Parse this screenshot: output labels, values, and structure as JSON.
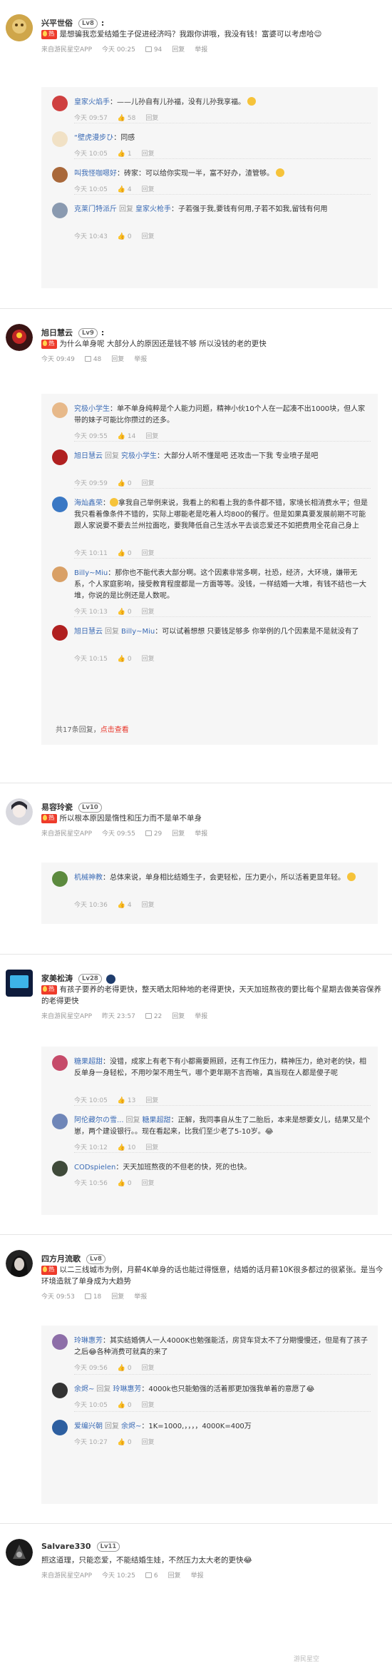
{
  "labels": {
    "reply": "回复",
    "report": "举报",
    "reply_word": "回复"
  },
  "threads": [
    {
      "user": "兴平世俗",
      "level": "Lv8",
      "badge": "热",
      "text": "是想骗我恋爱结婚生子促进经济吗？我跟你讲哦，我没有钱！富婆可以考虑哈😉",
      "source": "来自游民星空APP",
      "time": "今天 00:25",
      "likes": "94",
      "replies": [
        {
          "user": "皇家火焰手",
          "text": "——儿孙自有儿孙福，没有儿孙我享福。",
          "time": "今天 09:57",
          "likes": "58"
        },
        {
          "user": "“壁虎漫步ひ",
          "text": "同感",
          "time": "今天 10:05",
          "likes": "1"
        },
        {
          "user": "叫我怪咖嗯好",
          "text": "砖家：可以给你实现一半，富不好办，渣管够。",
          "time": "今天 10:05",
          "likes": "4"
        },
        {
          "user": "克莱门特派斤",
          "to": "皇家火枪手",
          "text": "子若强于我,要钱有何用,子若不如我,留钱有何用",
          "time": "今天 10:43",
          "likes": "0"
        }
      ]
    },
    {
      "user": "旭日慧云",
      "level": "Lv9",
      "badge": "热",
      "text": "为什么单身呢 大部分人的原因还是钱不够 所以没钱的老的更快",
      "source": "",
      "time": "今天 09:49",
      "likes": "48",
      "replies": [
        {
          "user": "究极小学生",
          "text": "单不单身纯粹是个人能力问题，精神小伙10个人在一起凑不出1000块，但人家带的妹子可能比你攒过的还多。",
          "time": "今天 09:55",
          "likes": "14"
        },
        {
          "user": "旭日慧云",
          "to": "究极小学生",
          "text": "大部分人听不懂是吧 还攻击一下我 专业喷子是吧",
          "time": "今天 09:59",
          "likes": "0"
        },
        {
          "user": "海灿鑫荣",
          "text": "拿我自己举例来说，我看上的和看上我的条件都不错，家境长相消费水平；但是我只看着像条件不错的，实际上哪能老是吃着人均800的餐厅。但是如果真要发展前期不可能跟人家说要不要去兰州拉面吃，要我降低自己生活水平去谈恋爱还不如把费用全花自己身上",
          "time": "今天 10:11",
          "likes": "0"
        },
        {
          "user": "Billy~Miu",
          "text": "那你也不能代表大部分啊。这个因素非常多啊，社恐，经济，大环境，嫌带无系，个人家庭影响，接受教育程度都是一方面等等。没钱，一样结婚一大堆，有钱不结也一大堆，你说的是比例还是人数呢。",
          "time": "今天 10:13",
          "likes": "0"
        },
        {
          "user": "旭日慧云",
          "to": "Billy~Miu",
          "text": "可以试着想想 只要钱足够多 你举例的几个因素是不是就没有了",
          "time": "今天 10:15",
          "likes": "0"
        }
      ],
      "more_count": "共17条回复，",
      "more_link": "点击查看"
    },
    {
      "user": "易容玲瓷",
      "level": "Lv10",
      "badge": "热",
      "text": "所以根本原因是惰性和压力而不是单不单身",
      "source": "来自游民星空APP",
      "time": "今天 09:55",
      "likes": "29",
      "replies": [
        {
          "user": "机械神教",
          "text": "总体来说，单身相比结婚生子，会更轻松，压力更小，所以活着更显年轻。",
          "time": "今天 10:36",
          "likes": "4"
        }
      ]
    },
    {
      "user": "家美松涛",
      "level": "Lv28",
      "badge": "热",
      "text": "有孩子要养的老得更快，整天晒太阳种地的老得更快，天天加班熬夜的要比每个星期去做美容保养的老得更快",
      "source": "来自游民星空APP",
      "time": "昨天 23:57",
      "likes": "22",
      "replies": [
        {
          "user": "糖果超甜",
          "text": "没错，成家上有老下有小都需要照顾，还有工作压力，精神压力，绝对老的快，相反单身一身轻松，不用吵架不用生气，哪个更年期不言而喻，真当现在人都是傻子呢",
          "time": "今天 10:05",
          "likes": "13"
        },
        {
          "user": "阿伦藏尔の雪...",
          "to": "糖果超甜",
          "text": "正解，我同事自从生了二胎后，本来是想要女儿，结果又是个崽，两个建设银行。。现在看起来，比我们至少老了5-10岁。😂",
          "time": "今天 10:12",
          "likes": "10"
        },
        {
          "user": "CODspielen",
          "text": "天天加班熬夜的不但老的快，死的也快。",
          "time": "今天 10:56",
          "likes": "0"
        }
      ]
    },
    {
      "user": "四方月流歌",
      "level": "Lv8",
      "badge": "热",
      "text": "以二三线城市为例，月薪4K单身的话也能过得惬意，结婚的话月薪10K很多都过的很紧张。是当今环境造就了单身成为大趋势",
      "source": "",
      "time": "今天 09:53",
      "likes": "18",
      "replies": [
        {
          "user": "玲琳惠芳",
          "text": "其实结婚俩人一人4000K也勉强能活，房贷车贷太不了分期慢慢还，但是有了孩子之后😂各种消费可就真的来了",
          "time": "今天 09:56",
          "likes": "0"
        },
        {
          "user": "余烬~",
          "to": "玲琳惠芳",
          "text": "4000k也只能勉强的活着那更加强我单着的意愿了😂",
          "time": "今天 10:05",
          "likes": "0"
        },
        {
          "user": "爱编兴朝",
          "to": "余烬~",
          "text": "1K=1000,，，，，4000K=400万",
          "time": "今天 10:27",
          "likes": "0"
        }
      ]
    },
    {
      "user": "Salvare330",
      "level": "Lv11",
      "badge": "",
      "text": "照这道理，只能恋爱，不能结婚生娃，不然压力太大老的更快😂",
      "source": "来自游民星空APP",
      "time": "今天 10:25",
      "likes": "6",
      "replies": []
    }
  ],
  "watermark": "游民星空",
  "colors": {
    "hot": "#ee3b2b",
    "link": "#3b6bb5",
    "bg_reply": "#f6f6f6"
  }
}
